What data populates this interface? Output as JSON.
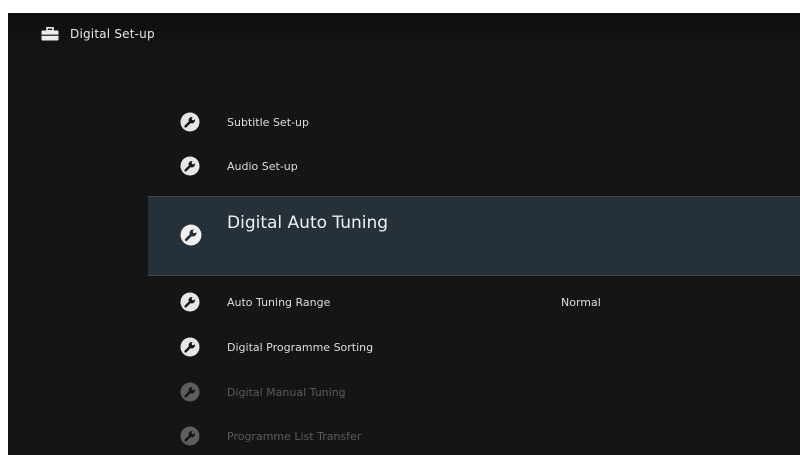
{
  "header": {
    "title": "Digital Set-up",
    "icon": "toolbox-icon"
  },
  "menu": {
    "items": [
      {
        "label": "Subtitle Set-up",
        "icon": "wrench-icon",
        "state": "normal"
      },
      {
        "label": "Audio Set-up",
        "icon": "wrench-icon",
        "state": "normal"
      },
      {
        "label": "Digital Auto Tuning",
        "icon": "wrench-icon",
        "state": "selected"
      },
      {
        "label": "Auto Tuning Range",
        "value": "Normal",
        "icon": "wrench-icon",
        "state": "normal"
      },
      {
        "label": "Digital Programme Sorting",
        "icon": "wrench-icon",
        "state": "normal"
      },
      {
        "label": "Digital Manual Tuning",
        "icon": "wrench-icon",
        "state": "disabled"
      },
      {
        "label": "Programme List Transfer",
        "icon": "wrench-icon",
        "state": "disabled"
      }
    ]
  },
  "colors": {
    "background": "#151515",
    "highlight": "#263039",
    "text": "#dedede",
    "disabled_text": "#5a5a5a"
  }
}
